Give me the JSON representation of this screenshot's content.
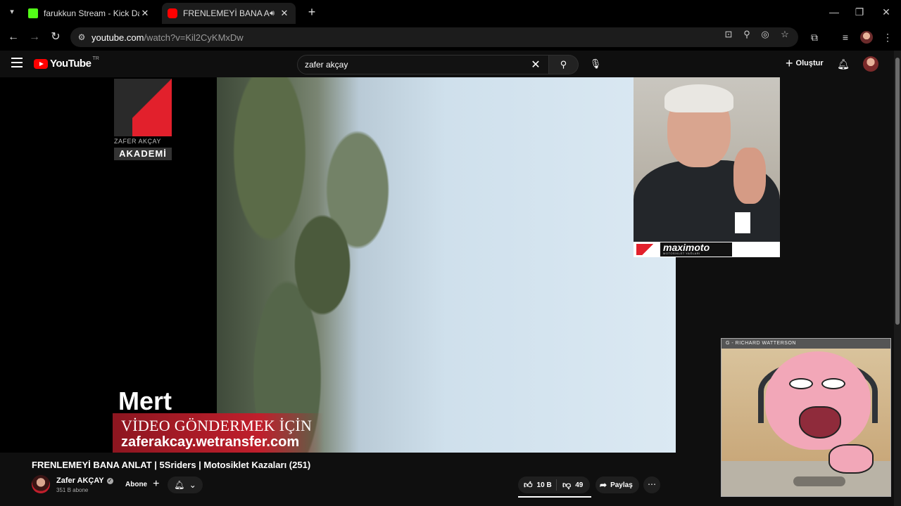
{
  "browser": {
    "tabs": [
      {
        "title": "farukkun Stream - Kick Dashboard",
        "favicon_color": "#53fc18"
      },
      {
        "title": "FRENLEMEYİ BANA ANLAT",
        "favicon_color": "#ff0000",
        "audio_icon": "speaker-icon"
      }
    ],
    "url_host": "youtube.com",
    "url_path": "/watch?v=Kil2CyKMxDw"
  },
  "youtube": {
    "logo_text": "YouTube",
    "country_code": "TR",
    "search_query": "zafer akçay",
    "create_label": "Oluştur"
  },
  "video": {
    "logo_caption": "ZAFER AKÇAY",
    "logo_badge": "AKADEMİ",
    "lower_name": "Mert",
    "lower_line1": "VİDEO GÖNDERMEK İÇİN",
    "lower_line2": "zaferakcay.wetransfer.com",
    "sponsor_text": "maximoto",
    "sponsor_sub": "MOTOSİKLET YAĞLARI",
    "accent_color": "#e2202c"
  },
  "details": {
    "title": "FRENLEMEYİ BANA ANLAT | 5Sriders | Motosiklet Kazaları (251)",
    "channel_name": "Zafer AKÇAY",
    "subscribers": "351 B abone",
    "subscribe_label": "Abone",
    "likes": "10 B",
    "dislikes": "49",
    "share_label": "Paylaş"
  },
  "pip": {
    "caption": "G - RICHARD WATTERSON"
  }
}
